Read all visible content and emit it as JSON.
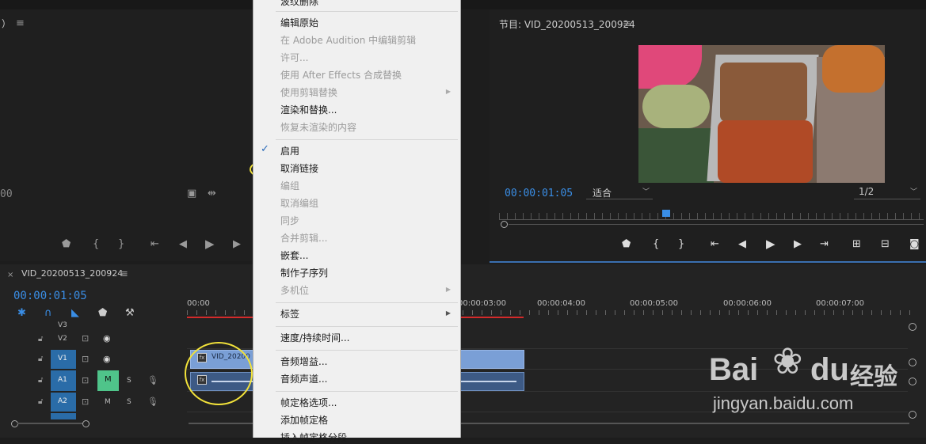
{
  "source_monitor": {
    "title": "）",
    "timecode": "00"
  },
  "program_monitor": {
    "title": "节目: VID_20200513_200924",
    "timecode": "00:00:01:05",
    "fit": "适合",
    "resolution": "1/2"
  },
  "timeline": {
    "title": "VID_20200513_200924",
    "timecode": "00:00:01:05",
    "ruler": [
      "00:00",
      "00:00:03:00",
      "00:00:04:00",
      "00:00:05:00",
      "00:00:06:00",
      "00:00:07:00"
    ],
    "tracks": [
      {
        "name": "V3"
      },
      {
        "name": "V2"
      },
      {
        "name": "V1"
      },
      {
        "name": "A1",
        "m": "M",
        "s": "S"
      },
      {
        "name": "A2",
        "m": "M",
        "s": "S"
      }
    ],
    "clip_label": "VID_20200"
  },
  "context_menu": {
    "items": [
      {
        "label": "波纹删除",
        "disabled": false
      },
      {
        "label": "编辑原始",
        "disabled": false
      },
      {
        "label": "在 Adobe Audition 中编辑剪辑",
        "disabled": true
      },
      {
        "label": "许可...",
        "disabled": true
      },
      {
        "label": "使用 After Effects 合成替换",
        "disabled": true
      },
      {
        "label": "使用剪辑替换",
        "disabled": true,
        "submenu": true
      },
      {
        "label": "渲染和替换...",
        "disabled": false
      },
      {
        "label": "恢复未渲染的内容",
        "disabled": true
      },
      {
        "label": "启用",
        "disabled": false,
        "checked": true
      },
      {
        "label": "取消链接",
        "disabled": false
      },
      {
        "label": "编组",
        "disabled": true
      },
      {
        "label": "取消编组",
        "disabled": true
      },
      {
        "label": "同步",
        "disabled": true
      },
      {
        "label": "合并剪辑...",
        "disabled": true
      },
      {
        "label": "嵌套...",
        "disabled": false
      },
      {
        "label": "制作子序列",
        "disabled": false
      },
      {
        "label": "多机位",
        "disabled": true,
        "submenu": true
      },
      {
        "label": "标签",
        "disabled": false,
        "submenu": true
      },
      {
        "label": "速度/持续时间...",
        "disabled": false
      },
      {
        "label": "音频增益...",
        "disabled": false
      },
      {
        "label": "音频声道...",
        "disabled": false
      },
      {
        "label": "帧定格选项...",
        "disabled": false
      },
      {
        "label": "添加帧定格",
        "disabled": false
      },
      {
        "label": "插入帧定格分段",
        "disabled": false
      }
    ]
  },
  "watermark": {
    "brand_a": "Bai",
    "brand_b": "du",
    "brand_c": "经验",
    "url": "jingyan.baidu.com"
  },
  "colors": {
    "accent": "#3a8ee6",
    "highlight": "#f2e23a",
    "clip_video": "#7a9fd6",
    "mute_active": "#4fc48a"
  }
}
